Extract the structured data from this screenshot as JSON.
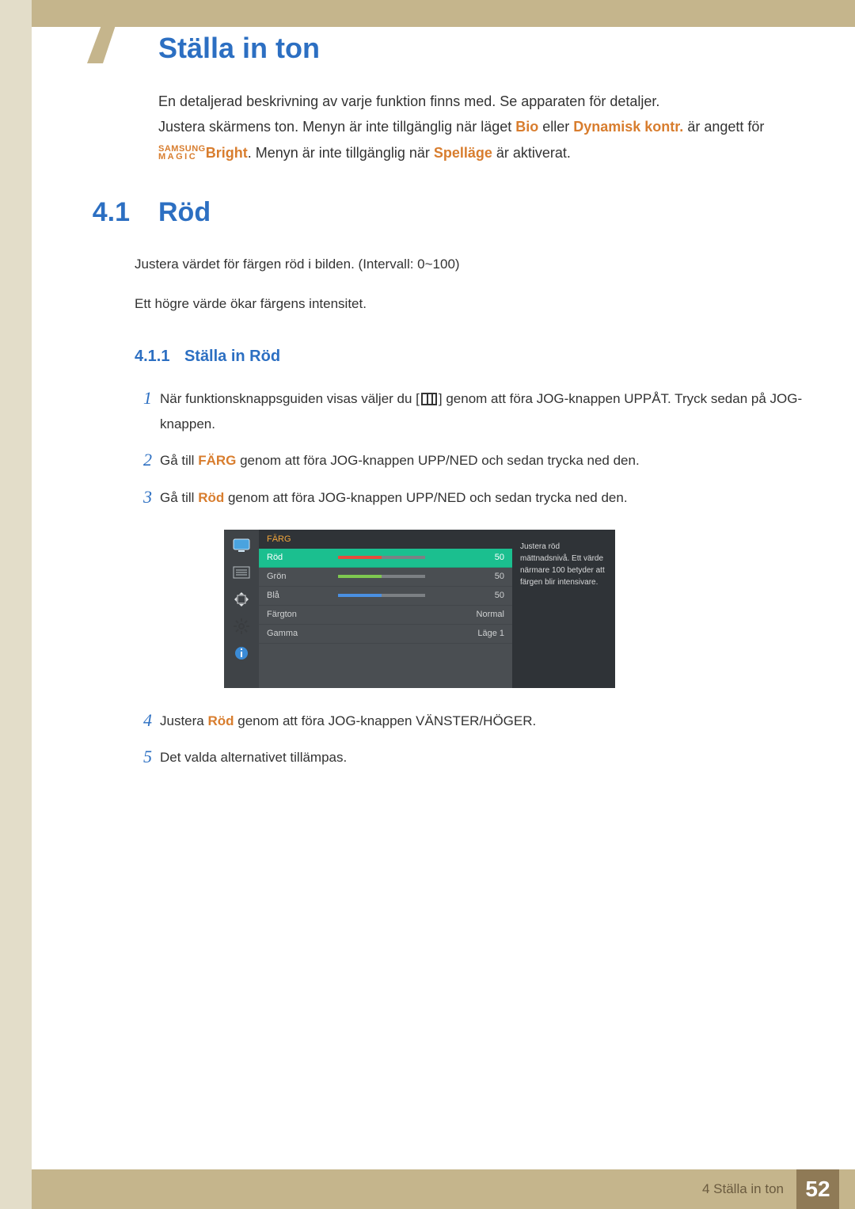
{
  "chapter": {
    "title": "Ställa in ton",
    "big_number": "4"
  },
  "intro": {
    "p1": "En detaljerad beskrivning av varje funktion finns med. Se apparaten för detaljer.",
    "p2_a": "Justera skärmens ton. Menyn är inte tillgänglig när läget ",
    "p2_bio": "Bio",
    "p2_b": " eller ",
    "p2_dyn": "Dynamisk kontr.",
    "p2_c": " är angett för ",
    "p2_brand_top": "SAMSUNG",
    "p2_brand_bot": "MAGIC",
    "p2_bright": "Bright",
    "p2_d": ". Menyn är inte tillgänglig när ",
    "p2_spell": "Spelläge",
    "p2_e": " är aktiverat."
  },
  "section": {
    "num": "4.1",
    "title": "Röd",
    "body_p1": "Justera värdet för färgen röd i bilden. (Intervall: 0~100)",
    "body_p2": "Ett högre värde ökar färgens intensitet."
  },
  "subsection": {
    "num": "4.1.1",
    "title": "Ställa in Röd"
  },
  "steps": {
    "s1_num": "1",
    "s1_a": "När funktionsknappsguiden visas väljer du [",
    "s1_b": "] genom att föra JOG-knappen UPPÅT. Tryck sedan på JOG-knappen.",
    "s2_num": "2",
    "s2_a": "Gå till ",
    "s2_farg": "FÄRG",
    "s2_b": " genom att föra JOG-knappen UPP/NED och sedan trycka ned den.",
    "s3_num": "3",
    "s3_a": "Gå till ",
    "s3_rod": "Röd",
    "s3_b": " genom att föra JOG-knappen UPP/NED och sedan trycka ned den.",
    "s4_num": "4",
    "s4_a": "Justera ",
    "s4_rod": "Röd",
    "s4_b": " genom att föra JOG-knappen VÄNSTER/HÖGER.",
    "s5_num": "5",
    "s5_a": "Det valda alternativet tillämpas."
  },
  "osd": {
    "header": "FÄRG",
    "rows": {
      "rod": {
        "label": "Röd",
        "value": "50"
      },
      "gron": {
        "label": "Grön",
        "value": "50"
      },
      "bla": {
        "label": "Blå",
        "value": "50"
      },
      "fargton": {
        "label": "Färgton",
        "value": "Normal"
      },
      "gamma": {
        "label": "Gamma",
        "value": "Läge 1"
      }
    },
    "sidetext": "Justera röd mättnadsnivå. Ett värde närmare 100 betyder att färgen blir intensivare.",
    "colors": {
      "rod": "#e74c3c",
      "gron": "#7ec850",
      "bla": "#4a90e2"
    }
  },
  "footer": {
    "label": "4 Ställa in ton",
    "page": "52"
  }
}
